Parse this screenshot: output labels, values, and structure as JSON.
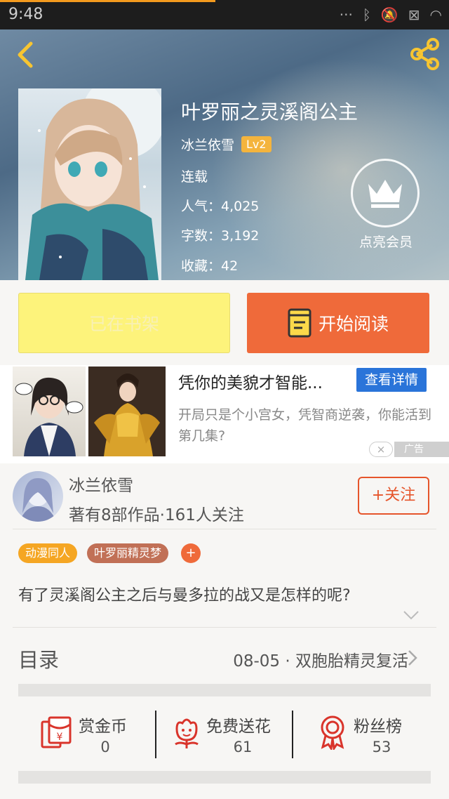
{
  "status_bar": {
    "time": "9:48",
    "icons": [
      "more-icon",
      "bluetooth-icon",
      "mute-icon",
      "battery-icon",
      "wifi-icon"
    ]
  },
  "book": {
    "title": "叶罗丽之灵溪阁公主",
    "author": "冰兰依雪",
    "author_level": "Lv2",
    "status": "连载",
    "popularity": "人气：4,025",
    "word_count": "字数：3,192",
    "favorites": "收藏：42",
    "vip_label": "点亮会员"
  },
  "actions": {
    "shelf_label": "已在书架",
    "read_label": "开始阅读"
  },
  "ad": {
    "title": "凭你的美貌才智能...",
    "button": "查看详情",
    "description": "开局只是个小宫女，凭智商逆袭，你能活到第几集?",
    "tag": "广告",
    "close": "×"
  },
  "author_card": {
    "name": "冰兰依雪",
    "stats": "著有8部作品·161人关注",
    "follow_label": "+关注"
  },
  "tags": [
    "动漫同人",
    "叶罗丽精灵梦",
    "+"
  ],
  "intro": "有了灵溪阁公主之后与曼多拉的战又是怎样的呢?",
  "catalog": {
    "title": "目录",
    "latest": "08-05 · 双胞胎精灵复活"
  },
  "stats": [
    {
      "label": "赏金币",
      "value": "0",
      "icon": "red-packet-icon"
    },
    {
      "label": "免费送花",
      "value": "61",
      "icon": "flower-icon"
    },
    {
      "label": "粉丝榜",
      "value": "53",
      "icon": "medal-icon"
    }
  ],
  "colors": {
    "accent": "#ef6a3a",
    "shelf": "#fdf37b",
    "level_badge": "#f4b43d",
    "ad_button": "#2a74d9",
    "tag_orange": "#f5a623",
    "tag_brown": "#c17056",
    "load_progress": "#f39a1e"
  },
  "page_load_progress": 0.48
}
